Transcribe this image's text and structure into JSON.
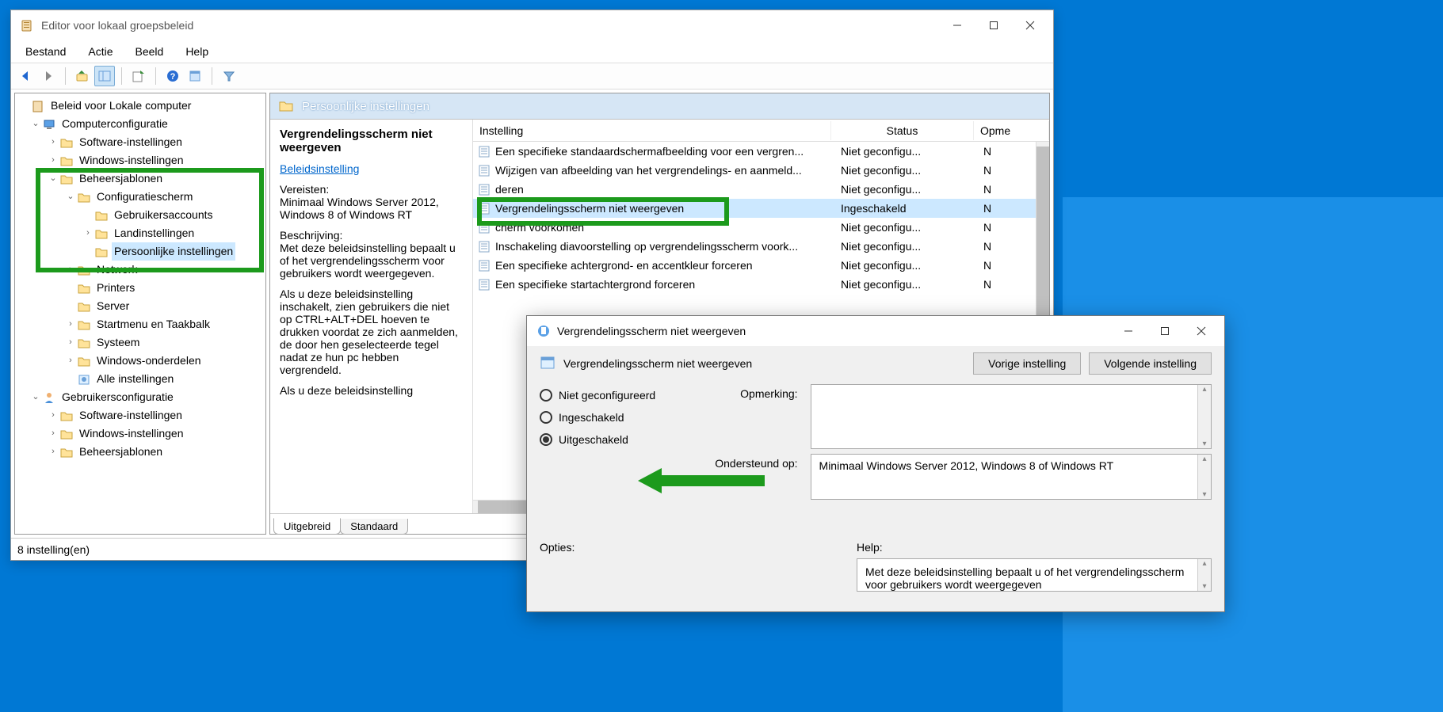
{
  "mainWindow": {
    "title": "Editor voor lokaal groepsbeleid",
    "menubar": [
      "Bestand",
      "Actie",
      "Beeld",
      "Help"
    ],
    "statusbar": "8 instelling(en)"
  },
  "tree": {
    "root": "Beleid voor Lokale computer",
    "computerConfig": "Computerconfiguratie",
    "softwareSettings": "Software-instellingen",
    "windowsSettings": "Windows-instellingen",
    "adminTemplates": "Beheersjablonen",
    "controlPanel": "Configuratiescherm",
    "userAccounts": "Gebruikersaccounts",
    "regional": "Landinstellingen",
    "personalization": "Persoonlijke instellingen",
    "network": "Netwerk",
    "printers": "Printers",
    "server": "Server",
    "startTaskbar": "Startmenu en Taakbalk",
    "system": "Systeem",
    "winComponents": "Windows-onderdelen",
    "allSettings": "Alle instellingen",
    "userConfig": "Gebruikersconfiguratie",
    "userSoftware": "Software-instellingen",
    "userWindows": "Windows-instellingen",
    "userAdmin": "Beheersjablonen"
  },
  "content": {
    "headerTitle": "Persoonlijke instellingen",
    "policyTitle": "Vergrendelingsscherm niet weergeven",
    "editLink": "Beleidsinstelling",
    "reqLabel": "Vereisten:",
    "reqText": "Minimaal Windows Server 2012, Windows 8 of Windows RT",
    "descLabel": "Beschrijving:",
    "descText1": "Met deze beleidsinstelling bepaalt u of het vergrendelingsscherm voor gebruikers wordt weergegeven.",
    "descText2": "Als u deze beleidsinstelling inschakelt, zien gebruikers die niet op CTRL+ALT+DEL hoeven te drukken voordat ze zich aanmelden, de door hen geselecteerde tegel nadat ze hun pc hebben vergrendeld.",
    "descText3": "Als u deze beleidsinstelling",
    "columns": {
      "name": "Instelling",
      "status": "Status",
      "comment": "Opme"
    },
    "rows": [
      {
        "name": "Een specifieke standaardschermafbeelding voor een vergren...",
        "status": "Niet geconfigu...",
        "comment": "N"
      },
      {
        "name": "Wijzigen van afbeelding van het vergrendelings- en aanmeld...",
        "status": "Niet geconfigu...",
        "comment": "N"
      },
      {
        "name": "                                                                                    deren",
        "status": "Niet geconfigu...",
        "comment": "N"
      },
      {
        "name": "Vergrendelingsscherm niet weergeven",
        "status": "Ingeschakeld",
        "comment": "N",
        "selected": true
      },
      {
        "name": "                                                                       cherm voorkomen",
        "status": "Niet geconfigu...",
        "comment": "N"
      },
      {
        "name": "Inschakeling diavoorstelling op vergrendelingsscherm voork...",
        "status": "Niet geconfigu...",
        "comment": "N"
      },
      {
        "name": "Een specifieke achtergrond- en accentkleur forceren",
        "status": "Niet geconfigu...",
        "comment": "N"
      },
      {
        "name": "Een specifieke startachtergrond forceren",
        "status": "Niet geconfigu...",
        "comment": "N"
      }
    ],
    "tabs": {
      "extended": "Uitgebreid",
      "standard": "Standaard"
    }
  },
  "dialog": {
    "title": "Vergrendelingsscherm niet weergeven",
    "subtitle": "Vergrendelingsscherm niet weergeven",
    "prev": "Vorige instelling",
    "next": "Volgende instelling",
    "radioNotConfigured": "Niet geconfigureerd",
    "radioEnabled": "Ingeschakeld",
    "radioDisabled": "Uitgeschakeld",
    "commentLabel": "Opmerking:",
    "supportedLabel": "Ondersteund op:",
    "supportedText": "Minimaal Windows Server 2012, Windows 8 of Windows RT",
    "optionsLabel": "Opties:",
    "helpLabel": "Help:",
    "helpText": "Met deze beleidsinstelling bepaalt u of het vergrendelingsscherm voor gebruikers wordt weergegeven"
  }
}
